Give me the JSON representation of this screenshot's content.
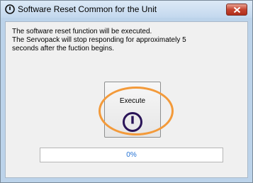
{
  "window": {
    "title": "Software Reset Common for the Unit"
  },
  "message": {
    "lines": [
      "The software reset function will be executed.",
      "The Servopack will stop responding for approximately 5",
      "seconds after the fuction begins."
    ]
  },
  "execute_button": {
    "label": "Execute",
    "icon": "power-icon"
  },
  "progress": {
    "percent_text": "0%",
    "value": 0
  },
  "colors": {
    "highlight_ring": "#f39a3a",
    "power_icon": "#2a1458",
    "progress_text": "#1f6fd3",
    "close_button": "#c4432f"
  }
}
